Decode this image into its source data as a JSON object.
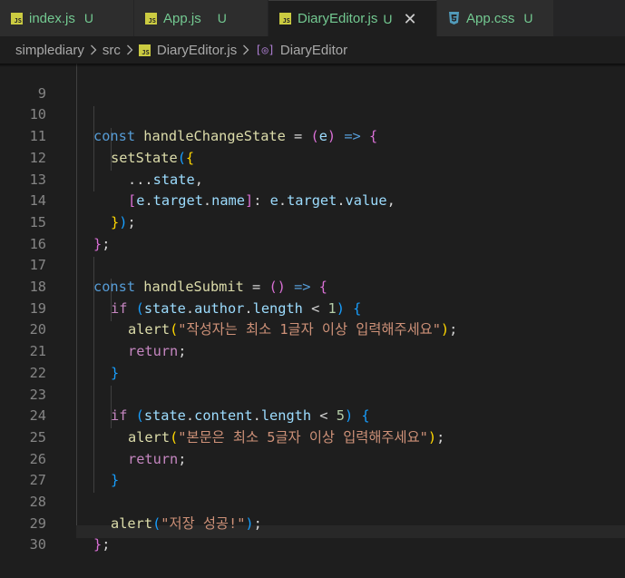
{
  "tabs": [
    {
      "label": "index.js",
      "status": "U",
      "icon": "js-file-icon",
      "active": false
    },
    {
      "label": "App.js",
      "status": "U",
      "icon": "js-file-icon",
      "active": false
    },
    {
      "label": "DiaryEditor.js",
      "status": "U",
      "icon": "js-file-icon",
      "active": true
    },
    {
      "label": "App.css",
      "status": "U",
      "icon": "css-file-icon",
      "active": false
    }
  ],
  "breadcrumb": {
    "folder": "simplediary",
    "subfolder": "src",
    "file": "DiaryEditor.js",
    "symbol": "DiaryEditor"
  },
  "code": {
    "line_numbers": [
      "9",
      "10",
      "11",
      "12",
      "13",
      "14",
      "15",
      "16",
      "17",
      "18",
      "19",
      "20",
      "21",
      "22",
      "23",
      "24",
      "25",
      "26",
      "27",
      "28",
      "29",
      "30"
    ],
    "t10": {
      "const": "const",
      "name": "handleChangeState",
      "eq": " = ",
      "lp": "(",
      "arg": "e",
      "rp": ")",
      "arrow": " => ",
      "lb": "{"
    },
    "t11": {
      "fn": "setState",
      "lp": "(",
      "lb": "{"
    },
    "t12": {
      "spread": "...",
      "state": "state",
      "comma": ","
    },
    "t13": {
      "lb": "[",
      "e": "e",
      "d1": ".",
      "target": "target",
      "d2": ".",
      "name": "name",
      "rb": "]",
      "colon": ": ",
      "e2": "e",
      "d3": ".",
      "target2": "target",
      "d4": ".",
      "value": "value",
      "comma": ","
    },
    "t14": {
      "rb": "}",
      "rp": ")",
      "semi": ";"
    },
    "t15": {
      "rb": "}",
      "semi": ";"
    },
    "t17": {
      "const": "const",
      "name": "handleSubmit",
      "eq": " = ",
      "params": "()",
      "arrow": " => ",
      "lb": "{"
    },
    "t18": {
      "if": "if",
      "lp": " (",
      "state": "state",
      "d1": ".",
      "author": "author",
      "d2": ".",
      "length": "length",
      "op": " < ",
      "num": "1",
      "rp": ")",
      "lb": " {"
    },
    "t19": {
      "fn": "alert",
      "lp": "(",
      "str": "\"작성자는 최소 1글자 이상 입력해주세요\"",
      "rp": ")",
      "semi": ";"
    },
    "t20": {
      "ret": "return",
      "semi": ";"
    },
    "t21": {
      "rb": "}"
    },
    "t23": {
      "if": "if",
      "lp": " (",
      "state": "state",
      "d1": ".",
      "content": "content",
      "d2": ".",
      "length": "length",
      "op": " < ",
      "num": "5",
      "rp": ")",
      "lb": " {"
    },
    "t24": {
      "fn": "alert",
      "lp": "(",
      "str": "\"본문은 최소 5글자 이상 입력해주세요\"",
      "rp": ")",
      "semi": ";"
    },
    "t25": {
      "ret": "return",
      "semi": ";"
    },
    "t26": {
      "rb": "}"
    },
    "t28": {
      "fn": "alert",
      "lp": "(",
      "str": "\"저장 성공!\"",
      "rp": ")",
      "semi": ";"
    },
    "t29": {
      "rb": "}",
      "semi": ";"
    }
  }
}
